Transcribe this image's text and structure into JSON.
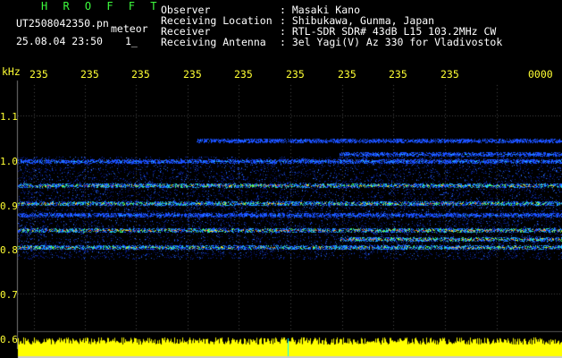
{
  "header": {
    "station_code": "H R O F F T",
    "filename": "UT2508042350.pn",
    "type_label": "meteor",
    "datetime": "25.08.04 23:50",
    "count": "1_",
    "fields": [
      {
        "label": "Observer",
        "value": ": Masaki Kano"
      },
      {
        "label": "Receiving Location",
        "value": ": Shibukawa, Gunma, Japan"
      },
      {
        "label": "Receiver",
        "value": ": RTL-SDR SDR# 43dB L15 103.2MHz CW"
      },
      {
        "label": "Receiving Antenna",
        "value": ": 3el Yagi(V) Az 330 for Vladivostok"
      }
    ]
  },
  "axis": {
    "unit": "kHz",
    "x_ticks": [
      "235",
      "235",
      "235",
      "235",
      "235",
      "235",
      "235",
      "235",
      "235",
      "0000"
    ],
    "y_ticks": [
      "1.1",
      "1.0",
      "0.9",
      "0.8",
      "0.7",
      "0.6"
    ]
  },
  "colors": {
    "background": "#000000",
    "station_code": "#3dfb3d",
    "tick_labels": "#ffff33",
    "signal_level": "#ffff00"
  }
}
